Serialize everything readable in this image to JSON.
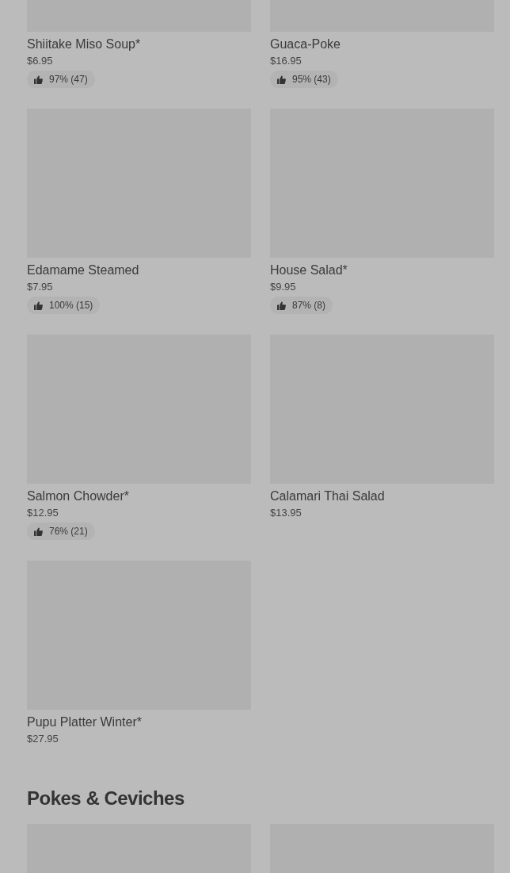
{
  "sections": [
    {
      "items": [
        {
          "kind": "dish",
          "name": "Shiitake Miso Soup*",
          "price": "$6.95",
          "rating": "97% (47)"
        },
        {
          "kind": "dish",
          "name": "Guaca-Poke",
          "price": "$16.95",
          "rating": "95% (43)"
        },
        {
          "kind": "dish",
          "name": "Edamame Steamed",
          "price": "$7.95",
          "rating": "100% (15)"
        },
        {
          "kind": "dish",
          "name": "House Salad*",
          "price": "$9.95",
          "rating": "87% (8)"
        },
        {
          "kind": "dish",
          "name": "Salmon Chowder*",
          "price": "$12.95",
          "rating": "76% (21)"
        },
        {
          "kind": "dish",
          "name": "Calamari Thai Salad",
          "price": "$13.95"
        },
        {
          "kind": "dish",
          "name": "Pupu Platter Winter*",
          "price": "$27.95"
        }
      ]
    },
    {
      "title": "Pokes & Ceviches",
      "items": [
        {
          "kind": "placeholder"
        },
        {
          "kind": "placeholder"
        }
      ]
    }
  ]
}
